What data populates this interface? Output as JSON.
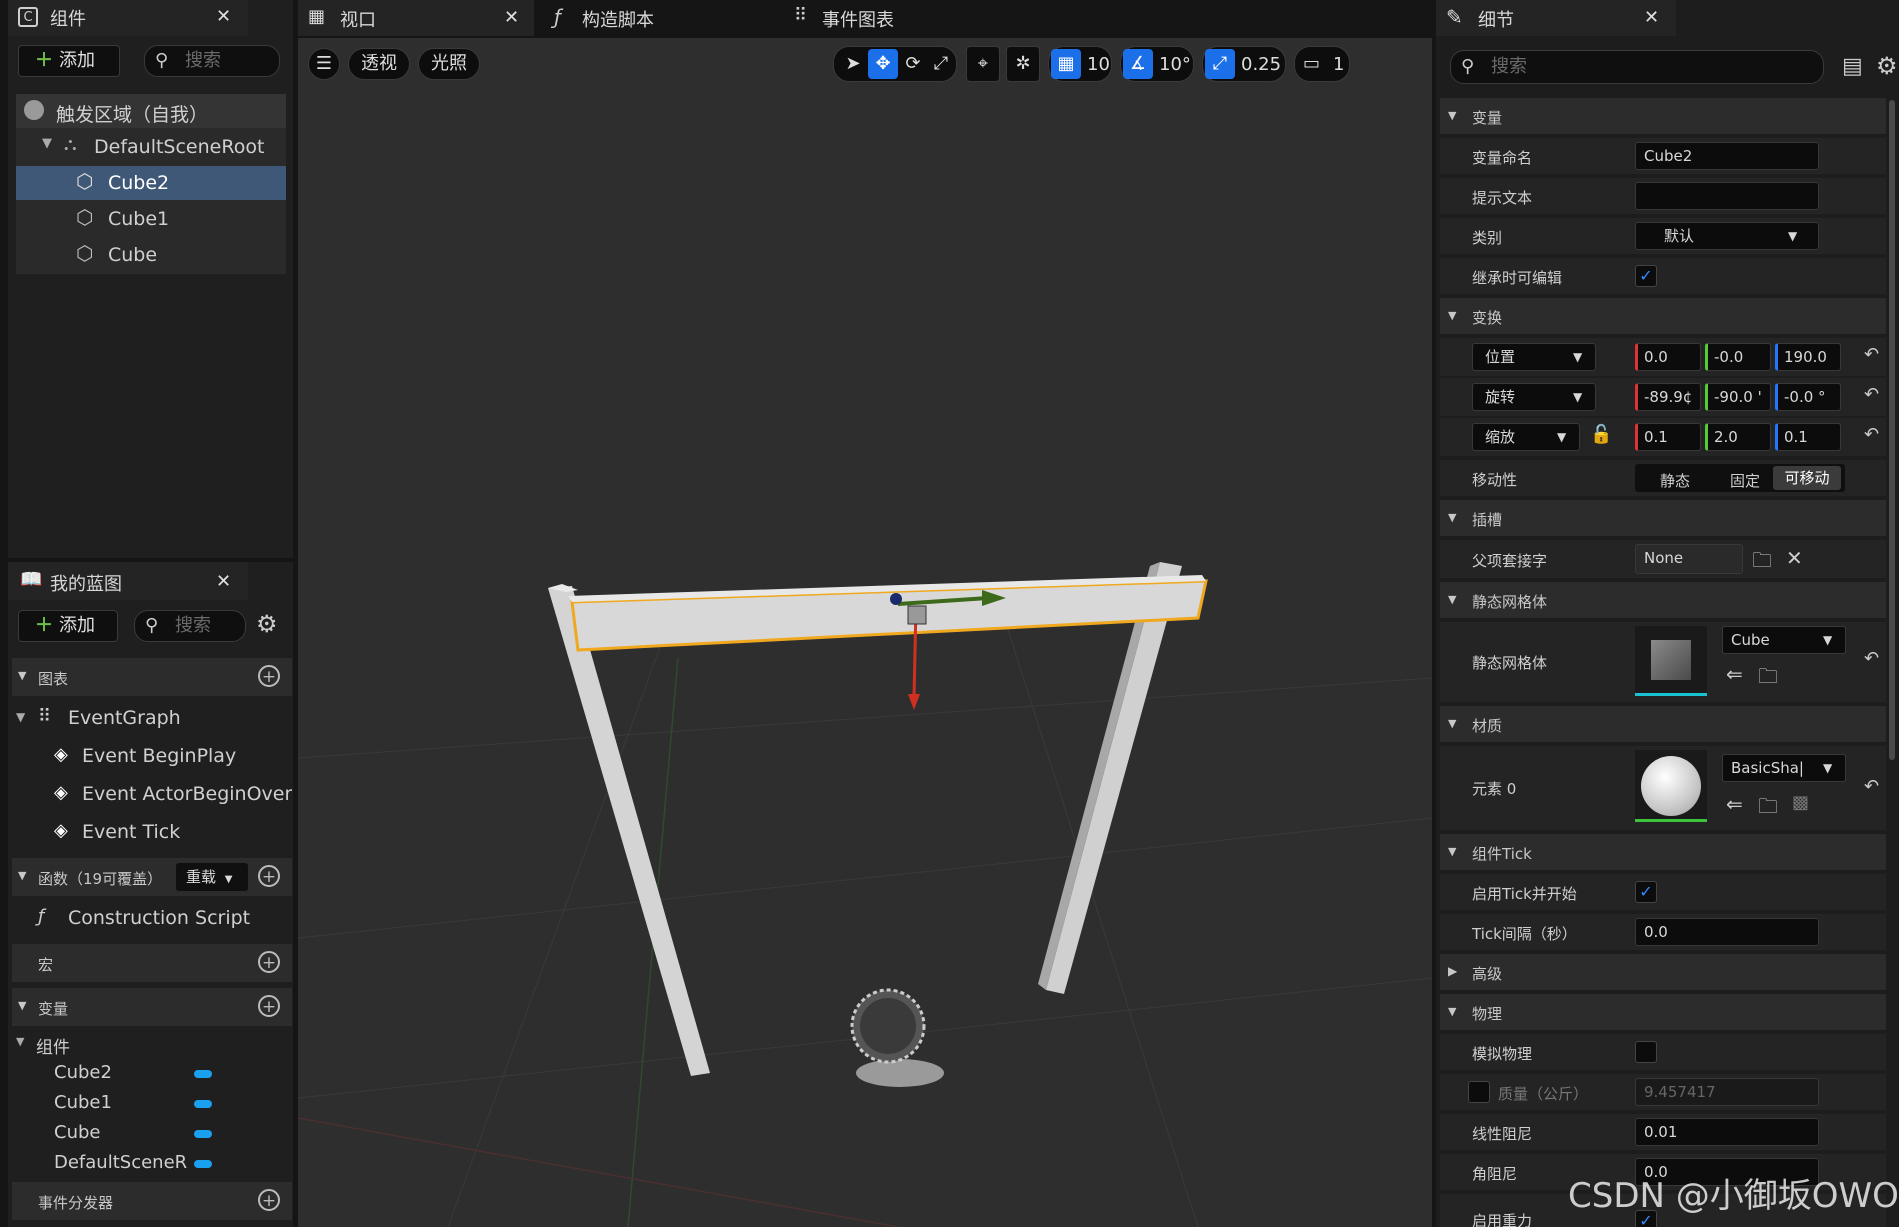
{
  "left": {
    "components_tab": "组件",
    "add_label": "添加",
    "search_placeholder": "搜索",
    "tree": {
      "root": "触发区域（自我）",
      "scene_root": "DefaultSceneRoot",
      "items": [
        "Cube2",
        "Cube1",
        "Cube"
      ]
    },
    "blueprint_tab": "我的蓝图",
    "sections": {
      "graphs": "图表",
      "event_graph": "EventGraph",
      "events": [
        "Event BeginPlay",
        "Event ActorBeginOverla",
        "Event Tick"
      ],
      "functions": "函数（19可覆盖）",
      "override": "重载",
      "construction": "Construction Script",
      "macros": "宏",
      "variables": "变量",
      "components": "组件",
      "var_items": [
        "Cube2",
        "Cube1",
        "Cube",
        "DefaultSceneR"
      ],
      "dispatchers": "事件分发器"
    }
  },
  "tabs": {
    "viewport": "视口",
    "construction": "构造脚本",
    "event_graph": "事件图表"
  },
  "viewport_toolbar": {
    "perspective": "透视",
    "lighting": "光照",
    "grid_snap": "10",
    "rot_snap": "10°",
    "scale_snap": "0.25",
    "camera_speed": "1"
  },
  "details": {
    "tab": "细节",
    "search_placeholder": "搜索",
    "variable_section": "变量",
    "var_name_label": "变量命名",
    "var_name_value": "Cube2",
    "tooltip_label": "提示文本",
    "category_label": "类别",
    "category_value": "默认",
    "editable_label": "继承时可编辑",
    "transform_section": "变换",
    "location_label": "位置",
    "location": [
      "0.0",
      "-0.0",
      "190.0"
    ],
    "rotation_label": "旋转",
    "rotation": [
      "-89.9¢",
      "-90.0 '",
      "-0.0 °"
    ],
    "scale_label": "缩放",
    "scale": [
      "0.1",
      "2.0",
      "0.1"
    ],
    "mobility_label": "移动性",
    "mobility": [
      "静态",
      "固定",
      "可移动"
    ],
    "socket_section": "插槽",
    "parent_socket_label": "父项套接字",
    "parent_socket_value": "None",
    "static_mesh_section": "静态网格体",
    "static_mesh_label": "静态网格体",
    "static_mesh_value": "Cube",
    "materials_section": "材质",
    "element0_label": "元素 0",
    "material_value": "BasicSha|",
    "tick_section": "组件Tick",
    "start_tick_label": "启用Tick并开始",
    "tick_interval_label": "Tick间隔（秒）",
    "tick_interval_value": "0.0",
    "advanced": "高级",
    "physics_section": "物理",
    "simulate_label": "模拟物理",
    "mass_label": "质量（公斤）",
    "mass_value": "9.457417",
    "linear_damping_label": "线性阻尼",
    "linear_damping_value": "0.01",
    "angular_damping_label": "角阻尼",
    "angular_damping_value": "0.0",
    "gravity_label": "启用重力"
  },
  "watermark": "CSDN @小御坂OWO",
  "colors": {
    "accent": "#1b6fe8",
    "selection": "#3f5878",
    "var_pill": "#1aa0f0",
    "gizmo_x": "#d03020",
    "gizmo_y": "#4a7a20"
  }
}
